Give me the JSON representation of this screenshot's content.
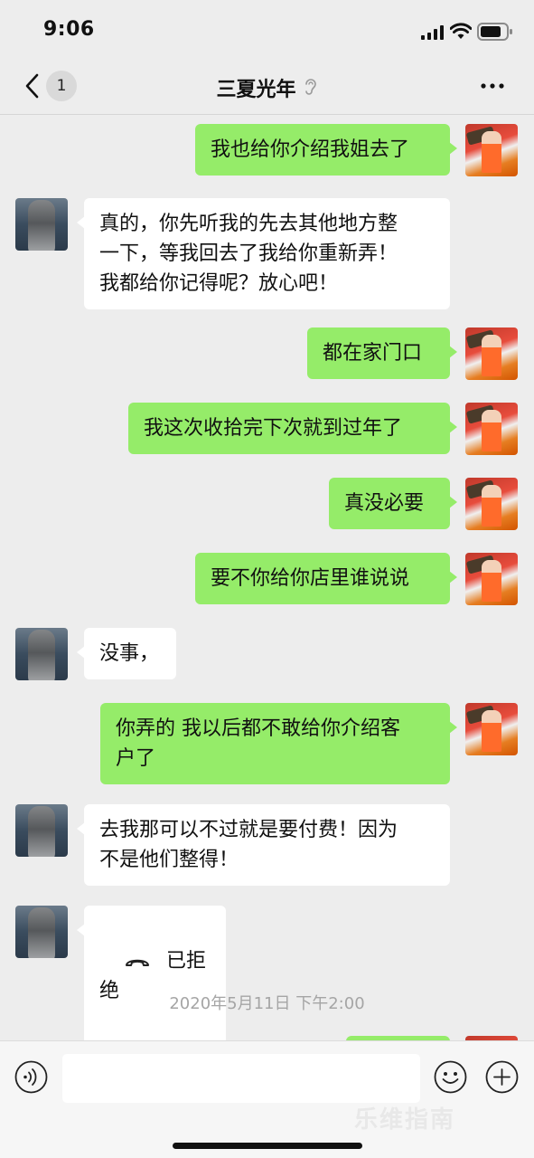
{
  "status_bar": {
    "time": "9:06"
  },
  "nav": {
    "unread_count": "1",
    "title": "三夏光年"
  },
  "messages": [
    {
      "side": "me",
      "text": "我也给你介绍我姐去了"
    },
    {
      "side": "other",
      "text": "真的，你先听我的先去其他地方整\n一下，等我回去了我给你重新弄！\n我都给你记得呢？放心吧！"
    },
    {
      "side": "me",
      "text": "都在家门口"
    },
    {
      "side": "me",
      "text": "我这次收拾完下次就到过年了"
    },
    {
      "side": "me",
      "text": "真没必要"
    },
    {
      "side": "me",
      "text": "要不你给你店里谁说说"
    },
    {
      "side": "other",
      "text": "没事，"
    },
    {
      "side": "me",
      "text": "你弄的 我以后都不敢给你介绍客\n户了"
    },
    {
      "side": "other",
      "text": "去我那可以不过就是要付费！因为\n不是他们整得！"
    },
    {
      "side": "other",
      "text": "已拒绝",
      "kind": "call-declined"
    }
  ],
  "timestamp": "2020年5月11日 下午2:00",
  "input": {
    "placeholder": ""
  },
  "watermark": "乐维指南",
  "colors": {
    "bubble_me": "#95ec69",
    "bubble_other": "#ffffff",
    "background": "#ededed"
  }
}
